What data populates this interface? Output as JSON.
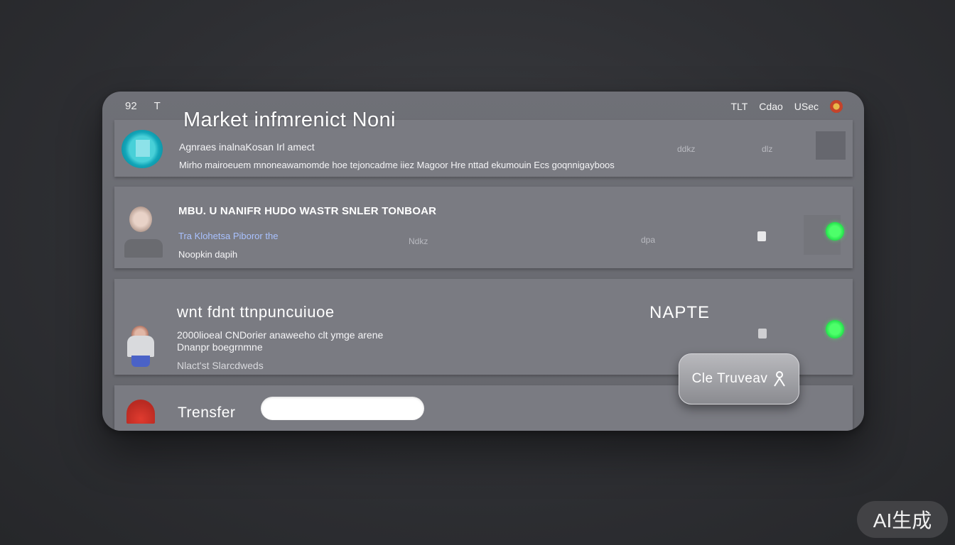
{
  "topbar": {
    "left": [
      "92",
      "T"
    ],
    "right": [
      "TLT",
      "Cdao",
      "USec"
    ],
    "avatar_icon": "user-avatar-icon"
  },
  "title": "Market infmrenict  Noni",
  "rows": [
    {
      "line1": "Agnraes inalnaKosan Irl amect",
      "line2": "Mirho mairoeuem mnoneawamomde hoe tejoncadme iiez Magoor Hre nttad ekumouin Ecs goqnnigayboos",
      "marks": [
        "ddkz",
        "dlz"
      ]
    },
    {
      "heading": "MBU. U NANIFR HUDO WASTR SNLER TONBOAR",
      "link": "Tra Klohetsa Piboror the",
      "meta": "Noopkin dapih",
      "center_mark": "Ndkz",
      "right_mark": "dpa",
      "status": "online"
    },
    {
      "heading": "wnt fdnt ttnpuncuiuoe",
      "line1": "2000lioeal CNDorier anaweeho clt ymge arene",
      "line2": "Dnanpr boegrnmne",
      "meta": "Nlact'st Slarcdweds",
      "label": "NAPTE",
      "status": "online"
    },
    {
      "label": "Trensfer",
      "input_value": ""
    }
  ],
  "float_button": {
    "label": "Cle Truveav",
    "icon": "person-icon"
  },
  "badge": "AI生成",
  "colors": {
    "panel": "#6f7077",
    "row": "#7a7b82",
    "status_online": "#2ee650",
    "accent_blue": "#a9c2ff"
  }
}
